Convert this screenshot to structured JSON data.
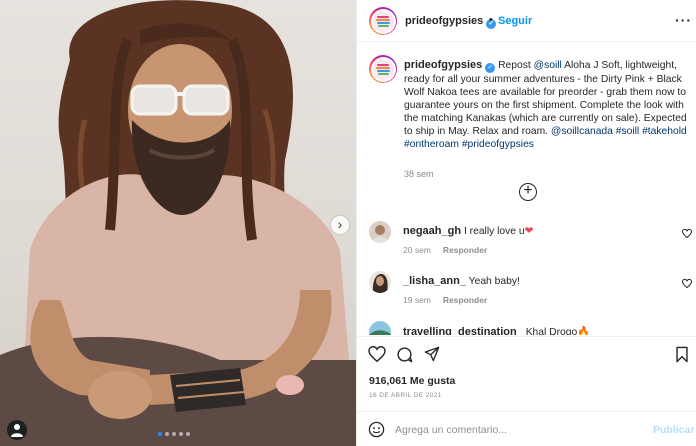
{
  "post": {
    "media": {
      "image_alt": "Man with long wavy hair, beard and light sunglasses wearing a pink t-shirt, seated with a tattooed forearm",
      "dots_total": 5,
      "dots_active": 1,
      "icons": {
        "next": "chevron-right-icon",
        "user_tag": "user-tag-icon"
      }
    },
    "header": {
      "username": "prideofgypsies",
      "separator": "•",
      "follow_label": "Seguir",
      "more_label": "···"
    },
    "caption": {
      "username": "prideofgypsies",
      "repost_label": "Repost",
      "repost_handle": "@soill",
      "repost_text": "Aloha J",
      "body": "Soft, lightweight, ready for all your summer adventures - the Dirty Pink + Black Wolf Nakoa tees are available for preorder - grab them now to guarantee yours on the first shipment. Complete the look with the matching Kanakas (which are currently on sale). Expected to ship in May. Relax and roam.",
      "tags": "@soillcanada #soill #takehold #ontheroam #prideofgypsies",
      "time": "38 sem"
    },
    "load_more_label": "+",
    "comments": [
      {
        "username": "negaah_gh",
        "text": "I really love u",
        "emoji": "❤",
        "time": "20 sem",
        "reply_label": "Responder"
      },
      {
        "username": "_lisha_ann_",
        "text": "Yeah baby!",
        "emoji": "",
        "time": "19 sem",
        "reply_label": "Responder"
      },
      {
        "username": "travelling_destination_",
        "text": "Khal Drogo",
        "emoji": "🔥",
        "time": "",
        "reply_label": ""
      }
    ],
    "actions": {
      "icons": [
        "heart-icon",
        "comment-icon",
        "share-icon",
        "bookmark-icon"
      ],
      "likes": "916,061 Me gusta",
      "date": "16 DE ABRIL DE 2021"
    },
    "comment_box": {
      "placeholder": "Agrega un comentario...",
      "publish_label": "Publicar"
    }
  },
  "colors": {
    "link": "#00376b",
    "follow": "#0095f6",
    "publish_disabled": "#b2dffc",
    "muted": "#8e8e8e",
    "border": "#efefef",
    "verified": "#3897f0",
    "heart_red": "#ed4956"
  }
}
